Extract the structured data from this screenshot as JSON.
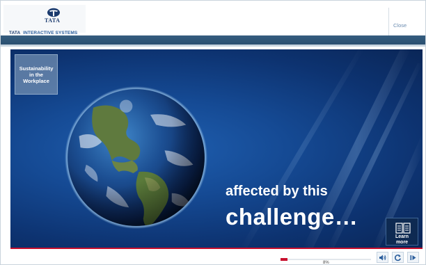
{
  "header": {
    "logo_word": "TATA",
    "company_brand": "TATA",
    "company_rest": "INTERACTIVE SYSTEMS",
    "close_label": "Close"
  },
  "slide": {
    "badge_lines": [
      "Sustainability",
      "in the",
      "Workplace"
    ],
    "caption_line1": "affected by this",
    "caption_line2": "challenge…"
  },
  "learn_more": {
    "label_line1": "Learn",
    "label_line2": "more",
    "icon": "book-icon"
  },
  "footer": {
    "progress_percent": 8,
    "progress_text": "8%",
    "controls": [
      {
        "name": "audio-button",
        "icon": "speaker-icon"
      },
      {
        "name": "replay-button",
        "icon": "replay-icon"
      },
      {
        "name": "next-button",
        "icon": "next-icon"
      }
    ]
  },
  "colors": {
    "accent_red": "#c8102e",
    "header_band": "#2f5678",
    "stage_blue": "#154a94",
    "brand_navy": "#1a3a6e"
  }
}
